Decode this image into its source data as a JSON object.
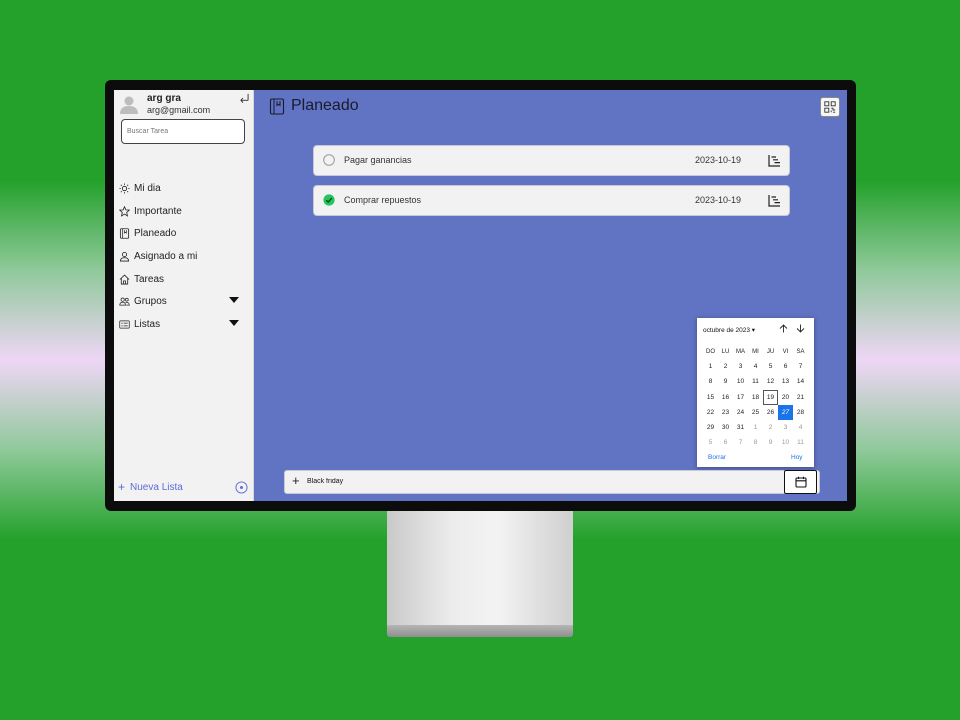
{
  "user": {
    "name": "arg gra",
    "email": "arg@gmail.com"
  },
  "search": {
    "placeholder": "Buscar Tarea"
  },
  "sidebar": {
    "items": [
      {
        "label": "Mi dia",
        "icon": "sun-icon"
      },
      {
        "label": "Importante",
        "icon": "star-icon"
      },
      {
        "label": "Planeado",
        "icon": "planner-icon"
      },
      {
        "label": "Asignado a mi",
        "icon": "person-icon"
      },
      {
        "label": "Tareas",
        "icon": "home-icon"
      },
      {
        "label": "Grupos",
        "icon": "group-icon",
        "expandable": true
      },
      {
        "label": "Listas",
        "icon": "list-icon",
        "expandable": true
      }
    ],
    "new_list_label": "Nueva Lista"
  },
  "page": {
    "title": "Planeado"
  },
  "tasks": [
    {
      "title": "Pagar ganancias",
      "date": "2023-10-19",
      "completed": false
    },
    {
      "title": "Comprar repuestos",
      "date": "2023-10-19",
      "completed": true
    }
  ],
  "add_task": {
    "value": "Black friday"
  },
  "calendar": {
    "month_label": "octubre de 2023 ▾",
    "weekdays": [
      "DO",
      "LU",
      "MA",
      "MI",
      "JU",
      "VI",
      "SA"
    ],
    "weeks": [
      [
        "1",
        "2",
        "3",
        "4",
        "5",
        "6",
        "7"
      ],
      [
        "8",
        "9",
        "10",
        "11",
        "12",
        "13",
        "14"
      ],
      [
        "15",
        "16",
        "17",
        "18",
        "19",
        "20",
        "21"
      ],
      [
        "22",
        "23",
        "24",
        "25",
        "26",
        "27",
        "28"
      ],
      [
        "29",
        "30",
        "31",
        "1",
        "2",
        "3",
        "4"
      ],
      [
        "5",
        "6",
        "7",
        "8",
        "9",
        "10",
        "11"
      ]
    ],
    "today_day": "19",
    "selected_day": "27",
    "clear_label": "Borrar",
    "today_label": "Hoy"
  },
  "colors": {
    "background": "#23a12a",
    "main_panel": "#6173c3",
    "accent": "#1a73e8",
    "done_check": "#22c55e",
    "link": "#5b6cd8"
  }
}
